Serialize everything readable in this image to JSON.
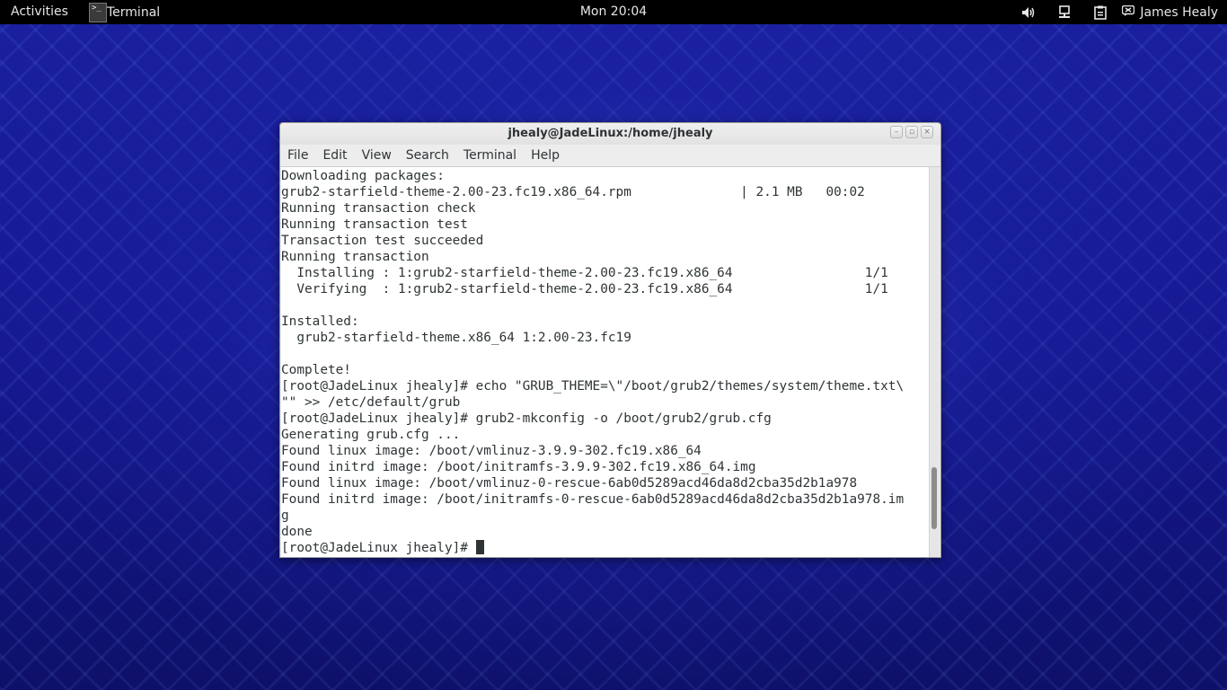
{
  "topbar": {
    "activities": "Activities",
    "app_name": "Terminal",
    "clock": "Mon 20:04",
    "user_name": "James Healy",
    "tray_icons": [
      "volume-icon",
      "network-icon",
      "clipboard-icon"
    ]
  },
  "window": {
    "title": "jhealy@JadeLinux:/home/jhealy",
    "menu": [
      "File",
      "Edit",
      "View",
      "Search",
      "Terminal",
      "Help"
    ],
    "buttons": [
      "minimize",
      "maximize",
      "close"
    ],
    "scroll_position": 0.92,
    "scroll_visible_fraction": 0.16
  },
  "terminal": {
    "lines": [
      "Downloading packages:",
      "grub2-starfield-theme-2.00-23.fc19.x86_64.rpm              | 2.1 MB   00:02",
      "Running transaction check",
      "Running transaction test",
      "Transaction test succeeded",
      "Running transaction",
      "  Installing : 1:grub2-starfield-theme-2.00-23.fc19.x86_64                 1/1",
      "  Verifying  : 1:grub2-starfield-theme-2.00-23.fc19.x86_64                 1/1",
      "",
      "Installed:",
      "  grub2-starfield-theme.x86_64 1:2.00-23.fc19",
      "",
      "Complete!",
      "[root@JadeLinux jhealy]# echo \"GRUB_THEME=\\\"/boot/grub2/themes/system/theme.txt\\",
      "\"\" >> /etc/default/grub",
      "[root@JadeLinux jhealy]# grub2-mkconfig -o /boot/grub2/grub.cfg",
      "Generating grub.cfg ...",
      "Found linux image: /boot/vmlinuz-3.9.9-302.fc19.x86_64",
      "Found initrd image: /boot/initramfs-3.9.9-302.fc19.x86_64.img",
      "Found linux image: /boot/vmlinuz-0-rescue-6ab0d5289acd46da8d2cba35d2b1a978",
      "Found initrd image: /boot/initramfs-0-rescue-6ab0d5289acd46da8d2cba35d2b1a978.im",
      "g",
      "done"
    ],
    "prompt": "[root@JadeLinux jhealy]# "
  }
}
